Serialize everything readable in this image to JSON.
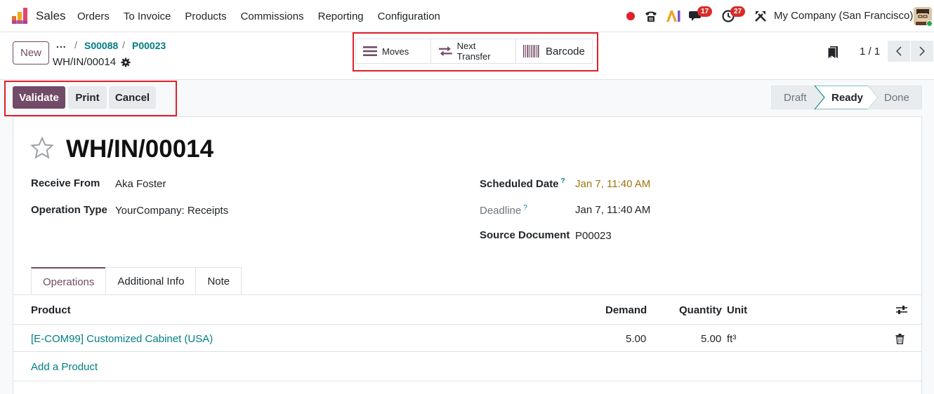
{
  "navbar": {
    "app_name": "Sales",
    "menu": [
      "Orders",
      "To Invoice",
      "Products",
      "Commissions",
      "Reporting",
      "Configuration"
    ],
    "messages_count": "17",
    "activities_count": "27",
    "company": "My Company (San Francisco)"
  },
  "control": {
    "new_label": "New",
    "breadcrumb_dots": "...",
    "breadcrumb": [
      "S00088",
      "P00023"
    ],
    "current": "WH/IN/00014",
    "smart_buttons": [
      {
        "icon": "list-icon",
        "label": "Moves"
      },
      {
        "icon": "transfer-icon",
        "label": "Next Transfer"
      },
      {
        "icon": "barcode-icon",
        "label": "Barcode"
      }
    ],
    "pager": "1 / 1"
  },
  "actions": {
    "validate": "Validate",
    "print": "Print",
    "cancel": "Cancel"
  },
  "stages": {
    "draft": "Draft",
    "ready": "Ready",
    "done": "Done",
    "current": "Ready"
  },
  "form": {
    "title": "WH/IN/00014",
    "receive_from_label": "Receive From",
    "receive_from": "Aka Foster",
    "operation_type_label": "Operation Type",
    "operation_type": "YourCompany: Receipts",
    "scheduled_date_label": "Scheduled Date",
    "scheduled_date": "Jan 7, 11:40 AM",
    "deadline_label": "Deadline",
    "deadline": "Jan 7, 11:40 AM",
    "source_document_label": "Source Document",
    "source_document": "P00023",
    "help_mark": "?"
  },
  "tabs": [
    "Operations",
    "Additional Info",
    "Note"
  ],
  "table": {
    "headers": {
      "product": "Product",
      "demand": "Demand",
      "quantity": "Quantity",
      "unit": "Unit"
    },
    "rows": [
      {
        "product": "[E-COM99] Customized Cabinet (USA)",
        "demand": "5.00",
        "quantity": "5.00",
        "unit": "ft³"
      }
    ],
    "add_line": "Add a Product"
  },
  "colors": {
    "brand": "#714b67",
    "link": "#017e84",
    "highlight": "#e0202a",
    "warning": "#a0740c"
  }
}
